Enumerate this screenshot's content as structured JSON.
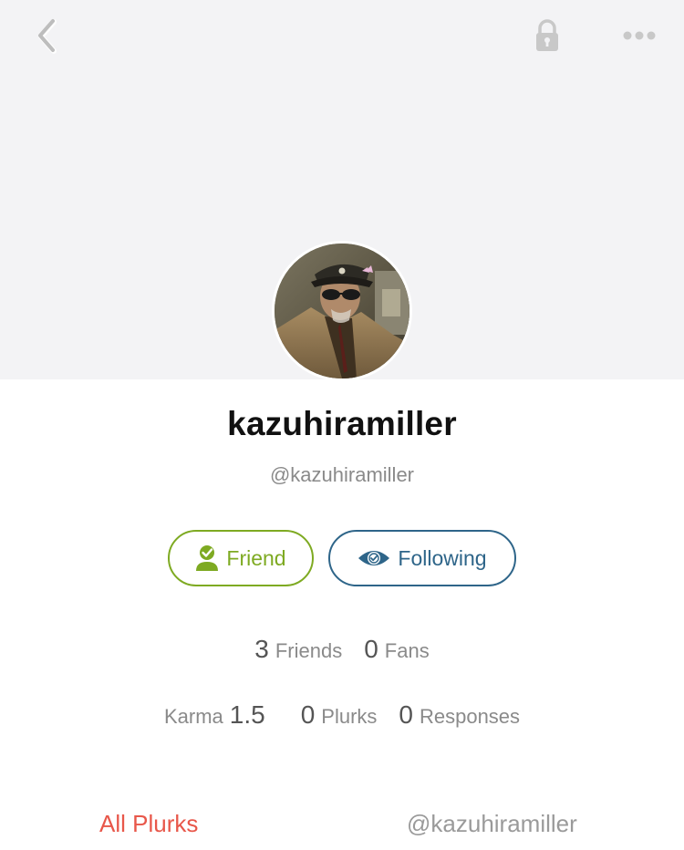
{
  "topbar": {
    "back_icon": "chevron-left-icon",
    "lock_icon": "lock-icon",
    "more_icon": "more-horizontal-icon"
  },
  "profile": {
    "display_name": "kazuhiramiller",
    "username": "@kazuhiramiller",
    "avatar": "avatar-photo"
  },
  "actions": {
    "friend_label": "Friend",
    "friend_icon": "person-check-icon",
    "following_label": "Following",
    "following_icon": "eye-check-icon"
  },
  "stats": {
    "friends_count": "3",
    "friends_label": "Friends",
    "fans_count": "0",
    "fans_label": "Fans",
    "karma_label": "Karma",
    "karma_value": "1.5",
    "plurks_count": "0",
    "plurks_label": "Plurks",
    "responses_count": "0",
    "responses_label": "Responses"
  },
  "tabs": [
    {
      "label": "All Plurks",
      "active": true
    },
    {
      "label": "@kazuhiramiller",
      "active": false
    }
  ],
  "colors": {
    "friend_green": "#7eaa22",
    "following_blue": "#2e6589",
    "active_tab_red": "#e8574a",
    "header_bg": "#f3f3f5"
  }
}
